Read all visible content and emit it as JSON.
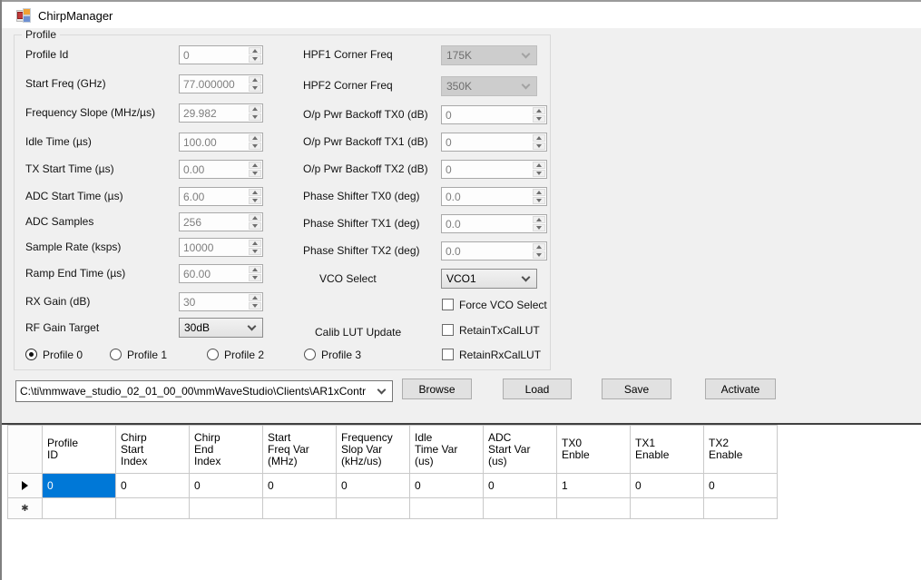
{
  "window": {
    "title": "ChirpManager"
  },
  "profile": {
    "group_label": "Profile",
    "left_fields": [
      {
        "label": "Profile Id",
        "value": "0"
      },
      {
        "label": "Start Freq (GHz)",
        "value": "77.000000"
      },
      {
        "label": "Frequency Slope (MHz/µs)",
        "value": "29.982"
      },
      {
        "label": "Idle Time (µs)",
        "value": "100.00"
      },
      {
        "label": "TX Start Time (µs)",
        "value": "0.00"
      },
      {
        "label": "ADC Start Time (µs)",
        "value": "6.00"
      },
      {
        "label": "ADC Samples",
        "value": "256"
      },
      {
        "label": "Sample Rate (ksps)",
        "value": "10000"
      },
      {
        "label": "Ramp End Time (µs)",
        "value": "60.00"
      },
      {
        "label": "RX Gain (dB)",
        "value": "30"
      }
    ],
    "rf_gain_target": {
      "label": "RF Gain Target",
      "value": "30dB"
    },
    "right_combos": [
      {
        "label": "HPF1 Corner Freq",
        "value": "175K"
      },
      {
        "label": "HPF2 Corner Freq",
        "value": "350K"
      }
    ],
    "right_spinners": [
      {
        "label": "O/p Pwr Backoff TX0 (dB)",
        "value": "0"
      },
      {
        "label": "O/p Pwr Backoff TX1 (dB)",
        "value": "0"
      },
      {
        "label": "O/p Pwr Backoff TX2 (dB)",
        "value": "0"
      },
      {
        "label": "Phase Shifter TX0 (deg)",
        "value": "0.0"
      },
      {
        "label": "Phase Shifter TX1 (deg)",
        "value": "0.0"
      },
      {
        "label": "Phase Shifter TX2 (deg)",
        "value": "0.0"
      }
    ],
    "vco_select": {
      "label": "VCO Select",
      "value": "VCO1"
    },
    "calib_lut_label": "Calib LUT Update",
    "checkboxes": [
      {
        "label": "Force VCO Select",
        "checked": false
      },
      {
        "label": "RetainTxCalLUT",
        "checked": false
      },
      {
        "label": "RetainRxCalLUT",
        "checked": false
      }
    ],
    "profiles": [
      {
        "label": "Profile 0",
        "selected": true
      },
      {
        "label": "Profile 1",
        "selected": false
      },
      {
        "label": "Profile 2",
        "selected": false
      },
      {
        "label": "Profile 3",
        "selected": false
      }
    ]
  },
  "file_bar": {
    "path": "C:\\ti\\mmwave_studio_02_01_00_00\\mmWaveStudio\\Clients\\AR1xContr",
    "browse": "Browse",
    "load": "Load",
    "save": "Save",
    "activate": "Activate"
  },
  "grid": {
    "columns": [
      "Profile\nID",
      "Chirp\nStart\nIndex",
      "Chirp\nEnd\nIndex",
      "Start\nFreq Var\n(MHz)",
      "Frequency\nSlop Var\n(kHz/us)",
      "Idle\nTime Var\n(us)",
      "ADC\nStart Var\n(us)",
      "TX0\nEnble",
      "TX1\nEnable",
      "TX2\nEnable"
    ],
    "rows": [
      {
        "cells": [
          "0",
          "0",
          "0",
          "0",
          "0",
          "0",
          "0",
          "1",
          "0",
          "0"
        ]
      }
    ],
    "new_row_glyph": "✱",
    "selection_color": "#0078D7"
  },
  "colors": {
    "dialog_bg": "#F0F0F0",
    "accent": "#0078D7",
    "disabled_bg": "#CDCDCD"
  }
}
